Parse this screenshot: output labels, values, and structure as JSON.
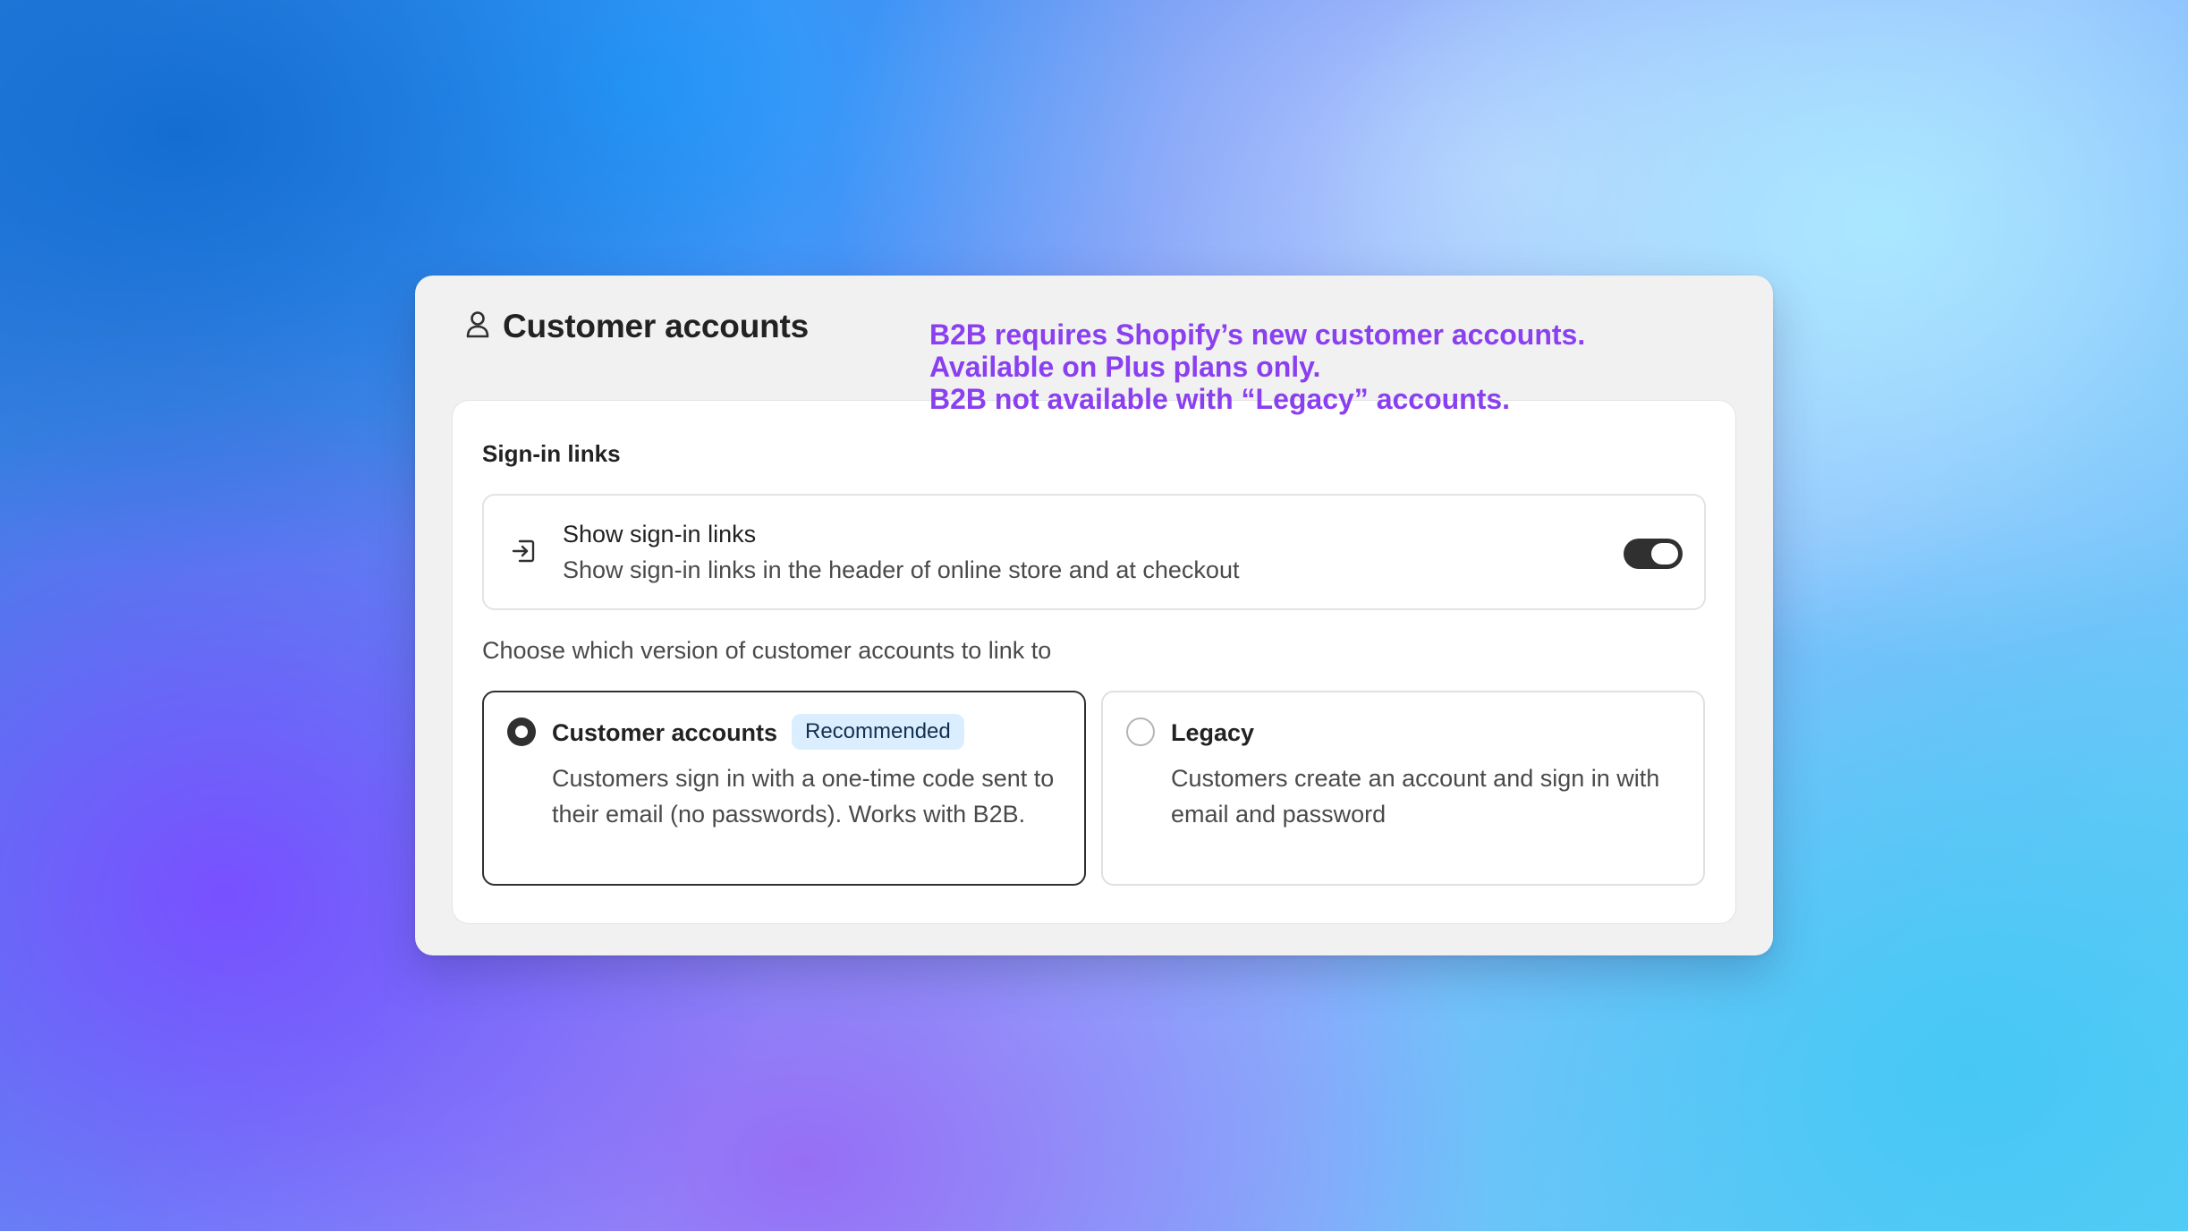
{
  "annotation": {
    "line1": "B2B requires Shopify’s new customer accounts.",
    "line2": "Available on Plus plans only.",
    "line3": "B2B not available with “Legacy” accounts.",
    "color": "#8a3ff0"
  },
  "card": {
    "title": "Customer accounts",
    "icon": "person-icon",
    "section_title": "Sign-in links",
    "toggle_row": {
      "icon": "sign-in-icon",
      "title": "Show sign-in links",
      "description": "Show sign-in links in the header of online store and at checkout",
      "enabled": true
    },
    "choose_label": "Choose which version of customer accounts to link to",
    "options": [
      {
        "title": "Customer accounts",
        "badge": "Recommended",
        "description": "Customers sign in with a one-time code sent to their email (no passwords). Works with B2B.",
        "selected": true
      },
      {
        "title": "Legacy",
        "description": "Customers create an account and sign in with email and password",
        "selected": false
      }
    ]
  }
}
